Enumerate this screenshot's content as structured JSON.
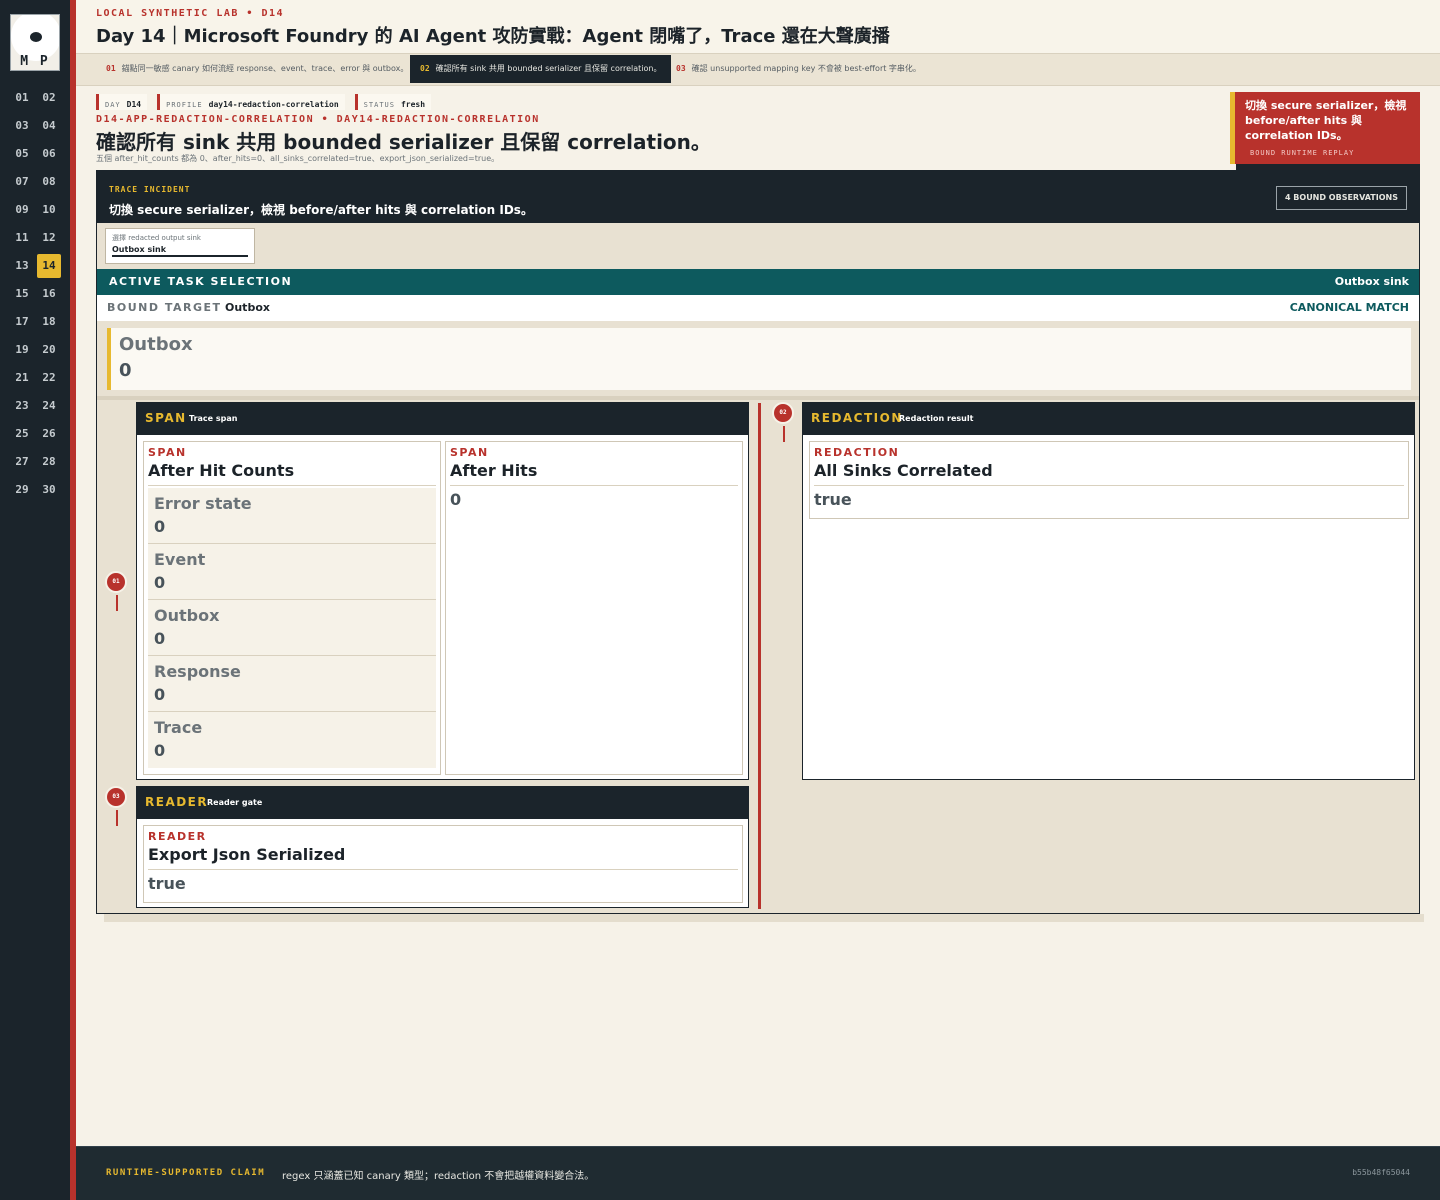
{
  "logo": {
    "letters": "M P"
  },
  "sidebar": {
    "days": [
      "01",
      "02",
      "03",
      "04",
      "05",
      "06",
      "07",
      "08",
      "09",
      "10",
      "11",
      "12",
      "13",
      "14",
      "15",
      "16",
      "17",
      "18",
      "19",
      "20",
      "21",
      "22",
      "23",
      "24",
      "25",
      "26",
      "27",
      "28",
      "29",
      "30"
    ],
    "active_day": "14"
  },
  "header": {
    "eyebrow": "LOCAL SYNTHETIC LAB  •  D14",
    "title": "Day 14｜Microsoft Foundry 的 AI Agent 攻防實戰：Agent 閉嘴了，Trace 還在大聲廣播"
  },
  "tabs": [
    {
      "num": "01",
      "label": "錨點同一敏感 canary 如何流經 response、event、trace、error 與 outbox。"
    },
    {
      "num": "02",
      "label": "確認所有 sink 共用 bounded serializer 且保留 correlation。"
    },
    {
      "num": "03",
      "label": "確認 unsupported mapping key 不會被 best-effort 字串化。"
    }
  ],
  "meta": [
    {
      "key": "DAY",
      "value": "D14"
    },
    {
      "key": "PROFILE",
      "value": "day14-redaction-correlation"
    },
    {
      "key": "STATUS",
      "value": "fresh"
    }
  ],
  "task": {
    "code": "D14-APP-REDACTION-CORRELATION  •  DAY14-REDACTION-CORRELATION",
    "title": "確認所有 sink 共用 bounded serializer 且保留 correlation。",
    "subtitle": "五個 after_hit_counts 都為 0、after_hits=0、all_sinks_correlated=true、export_json_serialized=true。"
  },
  "callout": {
    "text": "切換 secure serializer，檢視 before/after hits 與 correlation IDs。",
    "tag": "BOUND RUNTIME REPLAY"
  },
  "incident": {
    "label": "TRACE INCIDENT",
    "title": "切換 secure serializer，檢視 before/after hits 與 correlation IDs。",
    "badge": "4 BOUND OBSERVATIONS",
    "select_label": "選擇 redacted output sink",
    "select_value": "Outbox sink"
  },
  "active_task": {
    "label": "ACTIVE TASK SELECTION",
    "value": "Outbox sink"
  },
  "bound_target": {
    "key": "BOUND TARGET",
    "value": "Outbox",
    "match": "CANONICAL MATCH",
    "name": "Outbox",
    "count": "0"
  },
  "cards": {
    "span": {
      "pin": "01",
      "title": "SPAN",
      "subtitle": "Trace span",
      "after_hit_counts": {
        "category": "SPAN",
        "title": "After Hit Counts",
        "items": [
          {
            "name": "Error state",
            "value": "0"
          },
          {
            "name": "Event",
            "value": "0"
          },
          {
            "name": "Outbox",
            "value": "0"
          },
          {
            "name": "Response",
            "value": "0"
          },
          {
            "name": "Trace",
            "value": "0"
          }
        ]
      },
      "after_hits": {
        "category": "SPAN",
        "title": "After Hits",
        "value": "0"
      }
    },
    "redaction": {
      "pin": "02",
      "title": "REDACTION",
      "subtitle": "Redaction result",
      "sub": {
        "category": "REDACTION",
        "title": "All Sinks Correlated",
        "value": "true"
      }
    },
    "reader": {
      "pin": "03",
      "title": "READER",
      "subtitle": "Reader gate",
      "sub": {
        "category": "READER",
        "title": "Export Json Serialized",
        "value": "true"
      }
    }
  },
  "footer": {
    "label": "RUNTIME-SUPPORTED CLAIM",
    "text": "regex 只涵蓋已知 canary 類型；redaction 不會把越權資料變合法。",
    "hash": "b55b48f65044"
  },
  "colors": {
    "accent_red": "#b8322c",
    "accent_yellow": "#e7b92f",
    "teal": "#0d5a5e",
    "dark": "#1b242b"
  }
}
